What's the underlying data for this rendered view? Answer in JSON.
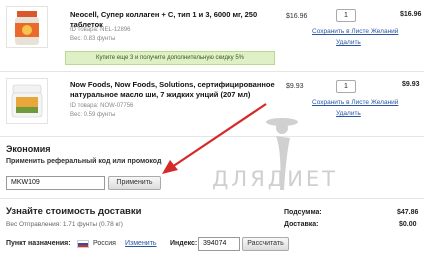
{
  "items": [
    {
      "title": "Neocell, Супер коллаген + С, тип 1 и 3, 6000 мг, 250 таблеток",
      "sku": "ID товара: NEL-12896",
      "weight": "Вес: 0.83 фунты",
      "price": "$16.96",
      "qty": "1",
      "save_label": "Сохранить в Листе Желаний",
      "delete_label": "Удалить",
      "total": "$16.96",
      "promo": "Купите еще 3 и получите дополнительную скидку 5%"
    },
    {
      "title_line1": "Now Foods, Now Foods, Solutions, сертифицированное",
      "title_line2": "натуральное масло ши, 7 жидких унций (207 мл)",
      "sku": "ID товара: NOW-07756",
      "weight": "Вес: 0.59 фунты",
      "price": "$9.93",
      "qty": "1",
      "save_label": "Сохранить в Листе Желаний",
      "delete_label": "Удалить",
      "total": "$9.93"
    }
  ],
  "savings": {
    "heading": "Экономия",
    "prompt": "Применить реферальный код или промокод",
    "code_value": "MKW109",
    "apply_label": "Применить"
  },
  "shipping": {
    "heading": "Узнайте стоимость доставки",
    "weight": "Вес Отправления: 1.71 фунты (0.78 кг)",
    "subtotal_label": "Подсумма:",
    "subtotal_value": "$47.86",
    "shipping_label": "Доставка:",
    "shipping_value": "$0.00",
    "destination_label": "Пункт назначения:",
    "country": "Россия",
    "change_label": "Изменить",
    "zip_label": "Индекс:",
    "zip_value": "394074",
    "calc_label": "Рассчитать"
  },
  "watermark": "ДЛЯДИЕТ",
  "colors": {
    "link": "#2a55a6",
    "promo_bg": "#dff0c6",
    "arrow": "#d42a2a"
  }
}
